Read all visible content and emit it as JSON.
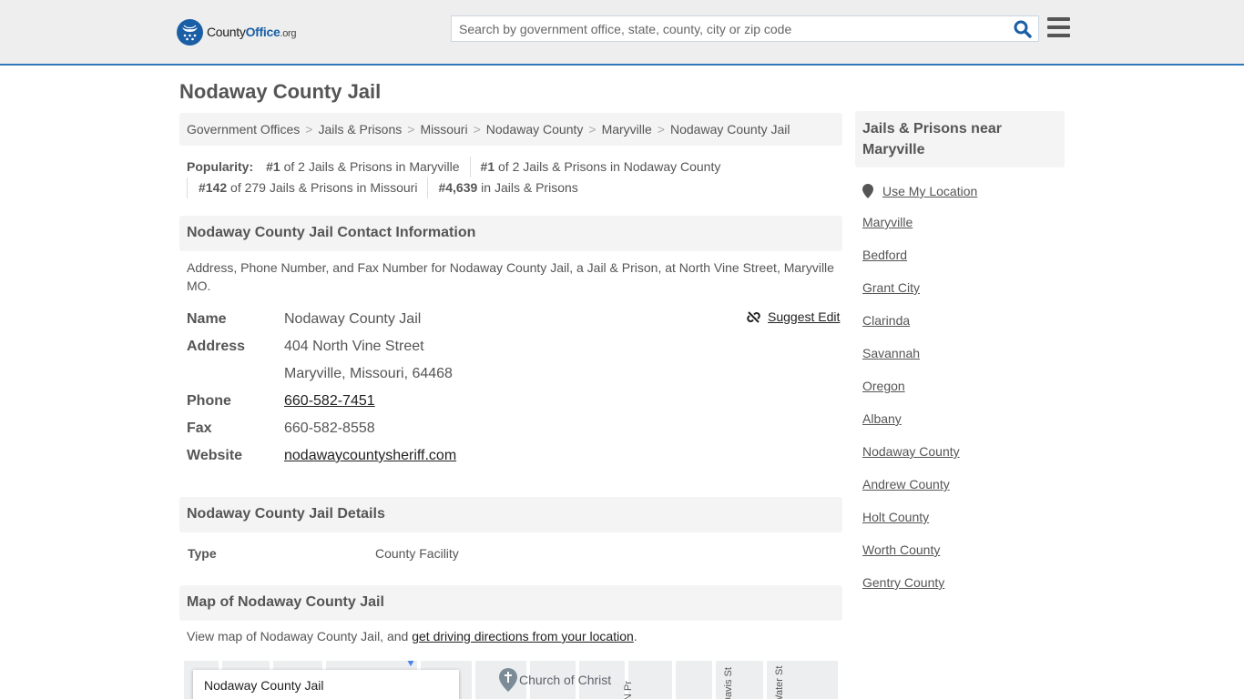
{
  "header": {
    "logo": {
      "name": "County",
      "brand": "Office",
      "tld": ".org"
    },
    "search": {
      "placeholder": "Search by government office, state, county, city or zip code",
      "value": ""
    },
    "colors": {
      "accent": "#2f79b8",
      "brand_blue": "#1a5fa6"
    }
  },
  "page": {
    "title": "Nodaway County Jail",
    "breadcrumb": [
      "Government Offices",
      "Jails & Prisons",
      "Missouri",
      "Nodaway County",
      "Maryville",
      "Nodaway County Jail"
    ],
    "popularity": {
      "label": "Popularity:",
      "items": [
        {
          "rank": "#1",
          "text": " of 2 Jails & Prisons in Maryville"
        },
        {
          "rank": "#1",
          "text": " of 2 Jails & Prisons in Nodaway County"
        },
        {
          "rank": "#142",
          "text": " of 279 Jails & Prisons in Missouri"
        },
        {
          "rank": "#4,639",
          "text": " in Jails & Prisons"
        }
      ]
    },
    "contact": {
      "heading": "Nodaway County Jail Contact Information",
      "description": "Address, Phone Number, and Fax Number for Nodaway County Jail, a Jail & Prison, at North Vine Street, Maryville MO.",
      "suggest_edit": "Suggest Edit",
      "rows": {
        "name": {
          "label": "Name",
          "value": "Nodaway County Jail"
        },
        "address": {
          "label": "Address",
          "line1": "404 North Vine Street",
          "line2": "Maryville, Missouri, 64468"
        },
        "phone": {
          "label": "Phone",
          "value": "660-582-7451"
        },
        "fax": {
          "label": "Fax",
          "value": "660-582-8558"
        },
        "website": {
          "label": "Website",
          "value": "nodawaycountysheriff.com"
        }
      }
    },
    "details": {
      "heading": "Nodaway County Jail Details",
      "type_label": "Type",
      "type_value": "County Facility"
    },
    "map": {
      "heading": "Map of Nodaway County Jail",
      "desc_prefix": "View map of Nodaway County Jail, and ",
      "desc_link": "get driving directions from your location",
      "desc_suffix": ".",
      "card_title": "Nodaway County Jail",
      "poi": "Church of Christ",
      "streets": [
        "N Pr",
        "Davis St",
        "Water St"
      ]
    }
  },
  "sidebar": {
    "heading": "Jails & Prisons near Maryville",
    "use_location": "Use My Location",
    "links": [
      "Maryville",
      "Bedford",
      "Grant City",
      "Clarinda",
      "Savannah",
      "Oregon",
      "Albany",
      "Nodaway County",
      "Andrew County",
      "Holt County",
      "Worth County",
      "Gentry County"
    ]
  }
}
